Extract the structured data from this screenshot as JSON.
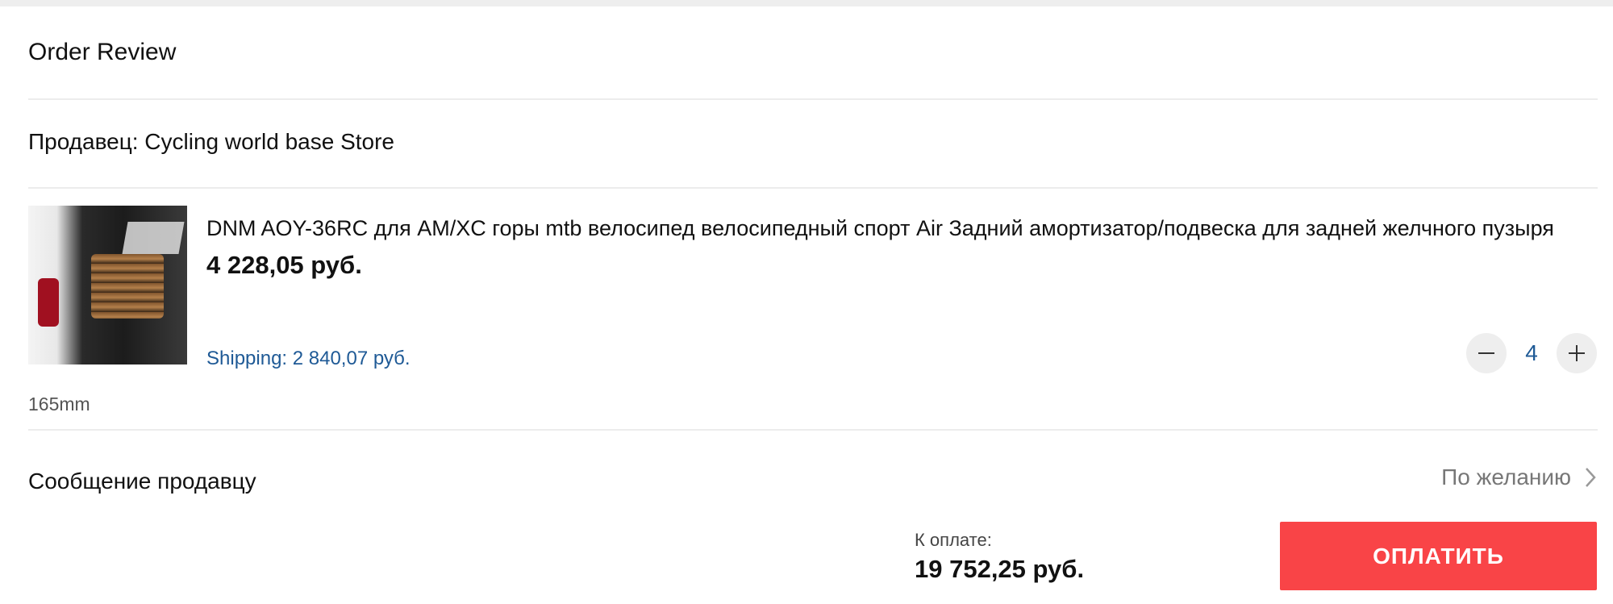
{
  "header": {
    "title": "Order Review"
  },
  "seller": {
    "label": "Продавец: Cycling world base Store"
  },
  "item": {
    "name": "DNM AOY-36RC для AM/XC горы mtb велосипед велосипедный спорт Air Задний амортизатор/подвеска для задней желчного пузыря",
    "price": "4 228,05 руб.",
    "shipping": "Shipping: 2 840,07 руб.",
    "quantity": "4",
    "variant": "165mm",
    "image_icon": "product-photo"
  },
  "message": {
    "label": "Сообщение продавцу",
    "optional": "По желанию"
  },
  "summary": {
    "total_label": "К оплате:",
    "total_value": "19 752,25 руб.",
    "pay_label": "ОПЛАТИТЬ"
  },
  "colors": {
    "accent": "#f94447",
    "link": "#1f5a96"
  }
}
